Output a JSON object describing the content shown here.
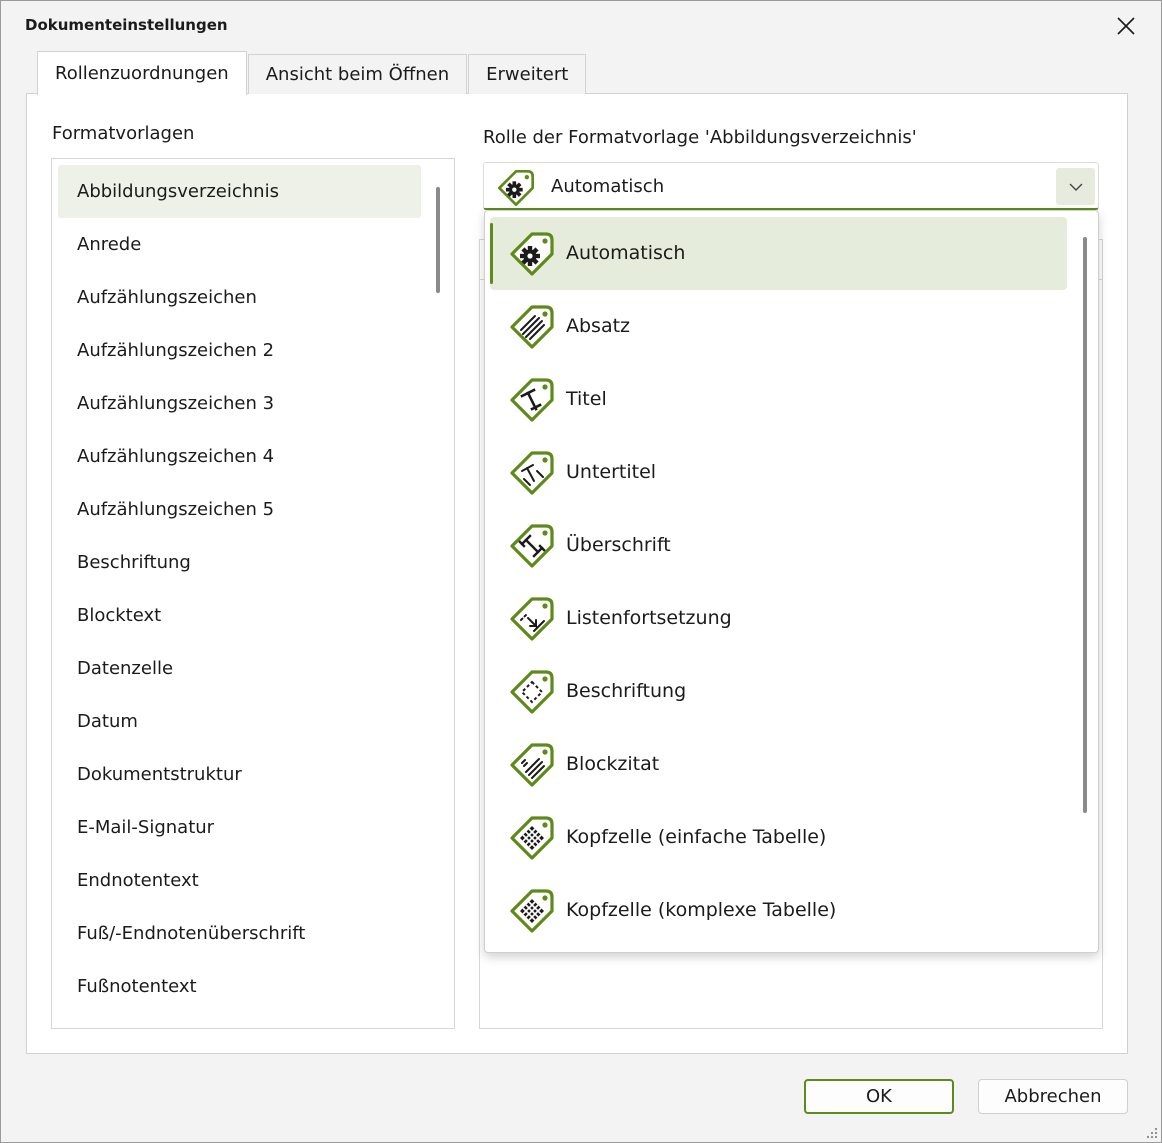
{
  "window": {
    "title": "Dokumenteinstellungen"
  },
  "tabs": [
    {
      "label": "Rollenzuordnungen",
      "active": true
    },
    {
      "label": "Ansicht beim Öffnen",
      "active": false
    },
    {
      "label": "Erweitert",
      "active": false
    }
  ],
  "formats": {
    "label": "Formatvorlagen",
    "items": [
      "Abbildungsverzeichnis",
      "Anrede",
      "Aufzählungszeichen",
      "Aufzählungszeichen 2",
      "Aufzählungszeichen 3",
      "Aufzählungszeichen 4",
      "Aufzählungszeichen 5",
      "Beschriftung",
      "Blocktext",
      "Datenzelle",
      "Datum",
      "Dokumentstruktur",
      "E-Mail-Signatur",
      "Endnotentext",
      "Fuß/-Endnotenüberschrift",
      "Fußnotentext"
    ],
    "selected_index": 0
  },
  "role": {
    "label": "Rolle der Formatvorlage 'Abbildungsverzeichnis'",
    "selected": "Automatisch",
    "options": [
      {
        "label": "Automatisch",
        "icon": "gear-icon"
      },
      {
        "label": "Absatz",
        "icon": "paragraph-icon"
      },
      {
        "label": "Titel",
        "icon": "title-icon"
      },
      {
        "label": "Untertitel",
        "icon": "subtitle-icon"
      },
      {
        "label": "Überschrift",
        "icon": "heading-icon"
      },
      {
        "label": "Listenfortsetzung",
        "icon": "list-continuation-icon"
      },
      {
        "label": "Beschriftung",
        "icon": "caption-icon"
      },
      {
        "label": "Blockzitat",
        "icon": "blockquote-icon"
      },
      {
        "label": "Kopfzelle (einfache Tabelle)",
        "icon": "table-header-icon"
      },
      {
        "label": "Kopfzelle (komplexe Tabelle)",
        "icon": "table-header-icon"
      }
    ]
  },
  "buttons": {
    "ok": "OK",
    "cancel": "Abbrechen"
  },
  "colors": {
    "accent": "#5e8a1a",
    "selection": "#e5ecdb",
    "list_selection": "#eef1e8"
  }
}
